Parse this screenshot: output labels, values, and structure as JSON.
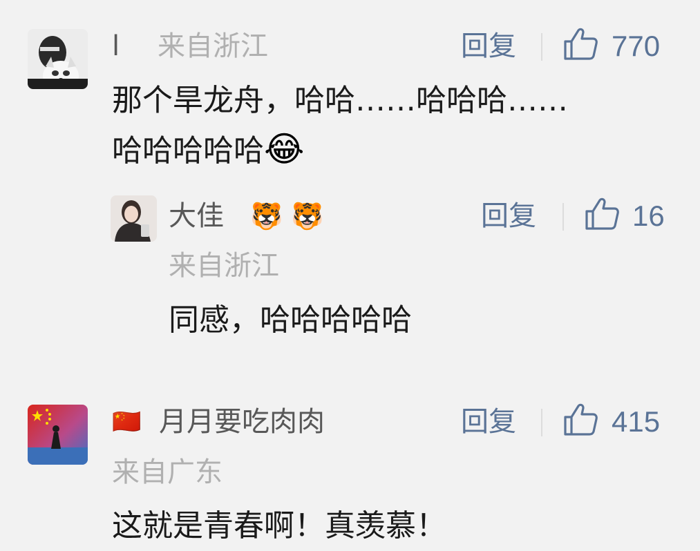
{
  "comments": [
    {
      "name": "l",
      "location": "来自浙江",
      "reply_label": "回复",
      "likes": "770",
      "text_line1": "那个旱龙舟，哈哈……哈哈哈……",
      "text_line2": "哈哈哈哈哈",
      "text_emoji": "😂",
      "reply": {
        "name": "大佳",
        "name_emoji": "🐯 🐯",
        "location": "来自浙江",
        "reply_label": "回复",
        "likes": "16",
        "text": "同感，哈哈哈哈哈"
      }
    },
    {
      "name_flag": "🇨🇳",
      "name": "月月要吃肉肉",
      "location": "来自广东",
      "reply_label": "回复",
      "likes": "415",
      "text": "这就是青春啊！真羡慕！"
    }
  ],
  "icons": {
    "like": "thumbs-up-outline",
    "avatar1": "person-with-dog-photo",
    "avatar2": "woman-photo",
    "avatar3": "china-flag-beach-photo"
  },
  "colors": {
    "background": "#f2f2f2",
    "action_blue": "#5a7396",
    "name_gray": "#585858",
    "location_gray": "#b0b0b0",
    "text_black": "#1a1a1a"
  }
}
